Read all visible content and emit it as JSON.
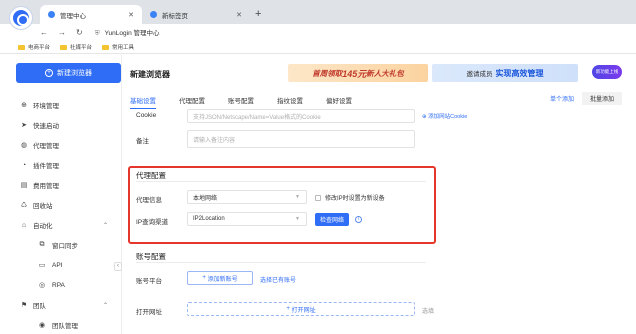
{
  "browser": {
    "active_tab": "管理中心",
    "inactive_tab": "新标签页",
    "address": "YunLogin 管理中心",
    "bookmarks": [
      "电商平台",
      "社媒平台",
      "常用工具"
    ]
  },
  "sidebar": {
    "new_button": "新建浏览器",
    "items": [
      {
        "label": "环境管理",
        "icon": "grid-icon"
      },
      {
        "label": "快速启动",
        "icon": "send-icon"
      },
      {
        "label": "代理管理",
        "icon": "globe-icon"
      },
      {
        "label": "插件管理",
        "icon": "plugin-icon"
      },
      {
        "label": "费用管理",
        "icon": "wallet-icon"
      },
      {
        "label": "回收站",
        "icon": "recycle-icon"
      },
      {
        "label": "自动化",
        "icon": "automation-icon"
      },
      {
        "label": "窗口同步",
        "icon": "window-sync-icon"
      },
      {
        "label": "API",
        "icon": "api-icon"
      },
      {
        "label": "RPA",
        "icon": "rpa-icon"
      },
      {
        "label": "团队",
        "icon": "team-icon"
      },
      {
        "label": "团队管理",
        "icon": "user-icon"
      }
    ]
  },
  "main": {
    "title": "新建浏览器",
    "banner_promo_prefix": "首周领取",
    "banner_promo_amount": "145元",
    "banner_promo_suffix": "新人大礼包",
    "banner_invite_prefix": "邀请成员",
    "banner_invite_highlight": "实现高效管理",
    "badge": "新功能上线",
    "tabs": [
      "基础设置",
      "代理配置",
      "账号配置",
      "指纹设置",
      "偏好设置"
    ],
    "side_tabs": [
      "单个添加",
      "批量添加"
    ],
    "cookie_label": "Cookie",
    "cookie_placeholder": "支持JSON/Netscape/Name=Value格式的Cookie",
    "cookie_link": "添加网站Cookie",
    "note_label": "备注",
    "note_placeholder": "请输入备注内容",
    "proxy_section_title": "代理配置",
    "proxy_info_label": "代理信息",
    "proxy_info_value": "本地网络",
    "proxy_checkbox_label": "修改IP时设置为新设备",
    "ip_channel_label": "IP查询渠道",
    "ip_channel_value": "IP2Location",
    "check_network_button": "检查网络",
    "account_section_title": "账号配置",
    "account_platform_label": "账号平台",
    "add_account_button": "添加新账号",
    "select_existing_link": "选择已有账号",
    "open_url_label": "打开网址",
    "open_url_button": "打开网址",
    "open_url_hint": "选填"
  }
}
